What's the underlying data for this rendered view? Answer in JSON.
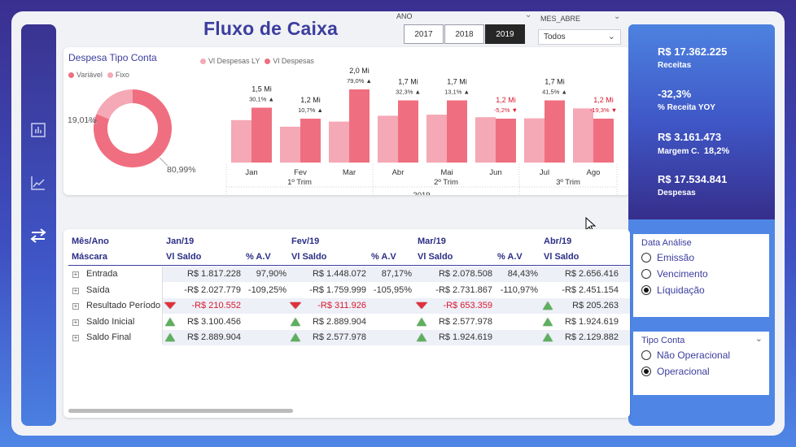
{
  "header": {
    "title": "Fluxo de Caixa"
  },
  "ano_slicer": {
    "label": "ANO",
    "options": [
      "2017",
      "2018",
      "2019"
    ],
    "selected": "2019"
  },
  "mes_slicer": {
    "label": "MES_ABRE",
    "value": "Todos"
  },
  "donut": {
    "title": "Despesa Tipo Conta",
    "legend": [
      "Variável",
      "Fixo"
    ],
    "colors": [
      "#ef6f80",
      "#f5a8b5"
    ],
    "slices": [
      {
        "name": "Variável",
        "pct": 80.99,
        "label": "80,99%"
      },
      {
        "name": "Fixo",
        "pct": 19.01,
        "label": "19,01%"
      }
    ]
  },
  "chart_data": {
    "type": "bar",
    "legend": [
      "Vl Despesas LY",
      "Vl Despesas"
    ],
    "colors": {
      "ly": "#f5a8b5",
      "cur": "#ef6f80",
      "up": "#1f2070",
      "down": "#d8192e"
    },
    "categories": [
      "Jan",
      "Fev",
      "Mar",
      "Abr",
      "Mai",
      "Jun",
      "Jul",
      "Ago"
    ],
    "series": [
      {
        "name": "Vl Despesas LY",
        "values": [
          1.16,
          0.98,
          1.12,
          1.28,
          1.31,
          1.24,
          1.21,
          1.48
        ]
      },
      {
        "name": "Vl Despesas",
        "values": [
          1.5,
          1.2,
          2.0,
          1.7,
          1.7,
          1.2,
          1.7,
          1.2
        ]
      }
    ],
    "value_labels": [
      "1,5 Mi",
      "1,2 Mi",
      "2,0 Mi",
      "1,7 Mi",
      "1,7 Mi",
      "1,2 Mi",
      "1,7 Mi",
      "1,2 Mi"
    ],
    "variation_labels": [
      "30,1% ▲",
      "10,7% ▲",
      "79,0% ▲",
      "32,3% ▲",
      "13,1% ▲",
      "-5,2% ▼",
      "41,5% ▲",
      "-19,3% ▼"
    ],
    "variation_up": [
      true,
      true,
      true,
      true,
      true,
      false,
      true,
      false
    ],
    "quarters": [
      "1º Trim",
      "2º Trim",
      "3º Trim"
    ],
    "year": "2019",
    "ylim": [
      0,
      2.2
    ]
  },
  "kpis": [
    {
      "value": "R$ 17.362.225",
      "label": "Receitas"
    },
    {
      "value": "-32,3%",
      "label": "% Receita YOY"
    },
    {
      "value": "R$ 3.161.473",
      "label": "Margem C.",
      "extra": "18,2%"
    },
    {
      "value": "R$ 17.534.841",
      "label": "Despesas"
    }
  ],
  "data_analise": {
    "title": "Data Análise",
    "options": [
      "Emissão",
      "Vencimento",
      "Líquidação"
    ],
    "selected": "Líquidação"
  },
  "tipo_conta": {
    "title": "Tipo Conta",
    "options": [
      "Não Operacional",
      "Operacional"
    ],
    "selected": "Operacional"
  },
  "matrix": {
    "row_header_1": "Mês/Ano",
    "row_header_2": "Máscara",
    "months": [
      "Jan/19",
      "Fev/19",
      "Mar/19",
      "Abr/19"
    ],
    "col_saldo": "Vl Saldo",
    "col_av": "% A.V",
    "rows": [
      {
        "label": "Entrada",
        "cells": [
          [
            "R$ 1.817.228",
            "97,90%"
          ],
          [
            "R$ 1.448.072",
            "87,17%"
          ],
          [
            "R$ 2.078.508",
            "84,43%"
          ],
          [
            "R$ 2.656.416",
            ""
          ]
        ],
        "icons": [
          "",
          "",
          "",
          ""
        ]
      },
      {
        "label": "Saída",
        "cells": [
          [
            "-R$ 2.027.779",
            "-109,25%"
          ],
          [
            "-R$ 1.759.999",
            "-105,95%"
          ],
          [
            "-R$ 2.731.867",
            "-110,97%"
          ],
          [
            "-R$ 2.451.154",
            ""
          ]
        ],
        "icons": [
          "",
          "",
          "",
          ""
        ]
      },
      {
        "label": "Resultado Período",
        "cells": [
          [
            "-R$ 210.552",
            ""
          ],
          [
            "-R$ 311.926",
            ""
          ],
          [
            "-R$ 653.359",
            ""
          ],
          [
            "R$ 205.263",
            ""
          ]
        ],
        "icons": [
          "down",
          "down",
          "down",
          "up"
        ]
      },
      {
        "label": "Saldo Inicial",
        "cells": [
          [
            "R$ 3.100.456",
            ""
          ],
          [
            "R$ 2.889.904",
            ""
          ],
          [
            "R$ 2.577.978",
            ""
          ],
          [
            "R$ 1.924.619",
            ""
          ]
        ],
        "icons": [
          "up",
          "up",
          "up",
          "up"
        ]
      },
      {
        "label": "Saldo Final",
        "cells": [
          [
            "R$ 2.889.904",
            ""
          ],
          [
            "R$ 2.577.978",
            ""
          ],
          [
            "R$ 1.924.619",
            ""
          ],
          [
            "R$ 2.129.882",
            ""
          ]
        ],
        "icons": [
          "up",
          "up",
          "up",
          "up"
        ]
      }
    ]
  }
}
